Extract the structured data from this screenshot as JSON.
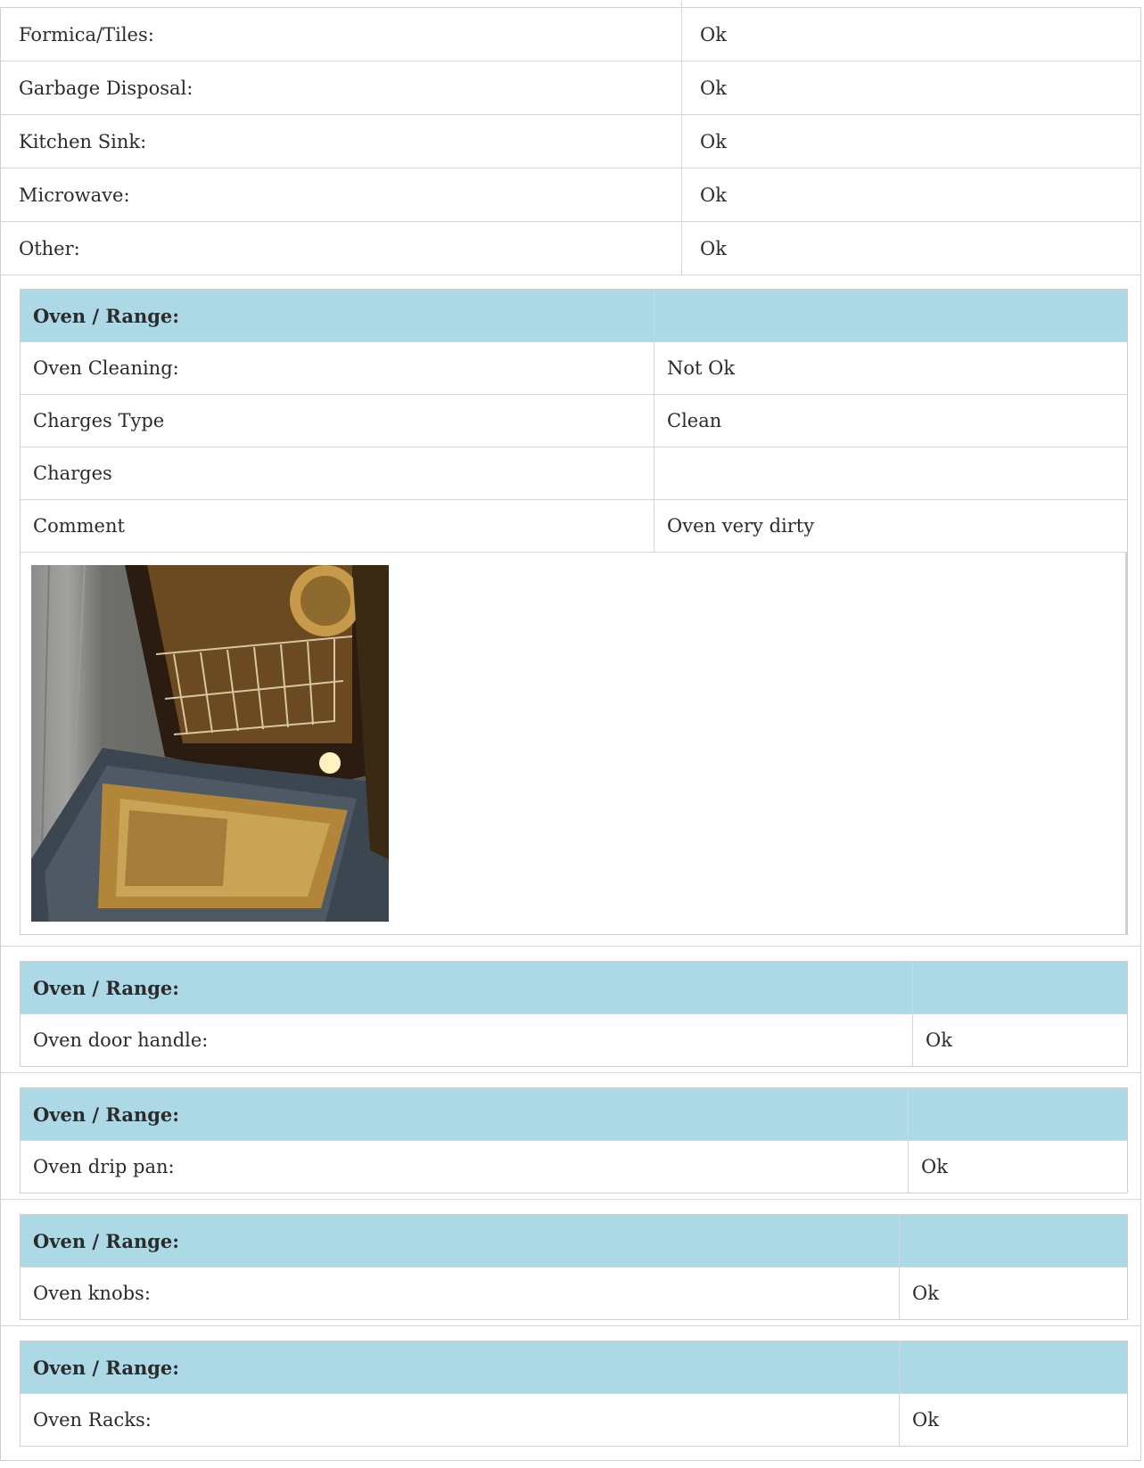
{
  "top_rows": [
    {
      "label": "Formica/Tiles:",
      "value": "Ok"
    },
    {
      "label": "Garbage Disposal:",
      "value": "Ok"
    },
    {
      "label": "Kitchen Sink:",
      "value": "Ok"
    },
    {
      "label": "Microwave:",
      "value": "Ok"
    },
    {
      "label": "Other:",
      "value": "Ok"
    }
  ],
  "section1": {
    "header": "Oven / Range:",
    "rows": [
      {
        "label": "Oven Cleaning:",
        "value": "Not Ok"
      },
      {
        "label": "Charges Type",
        "value": "Clean"
      },
      {
        "label": "Charges",
        "value": ""
      },
      {
        "label": "Comment",
        "value": "Oven very dirty"
      }
    ]
  },
  "section2": {
    "header": "Oven / Range:",
    "label": "Oven door handle:",
    "value": "Ok"
  },
  "section3": {
    "header": "Oven / Range:",
    "label": "Oven drip pan:",
    "value": "Ok"
  },
  "section4": {
    "header": "Oven / Range:",
    "label": "Oven knobs:",
    "value": "Ok"
  },
  "section5": {
    "header": "Oven / Range:",
    "label": "Oven Racks:",
    "value": "Ok"
  }
}
